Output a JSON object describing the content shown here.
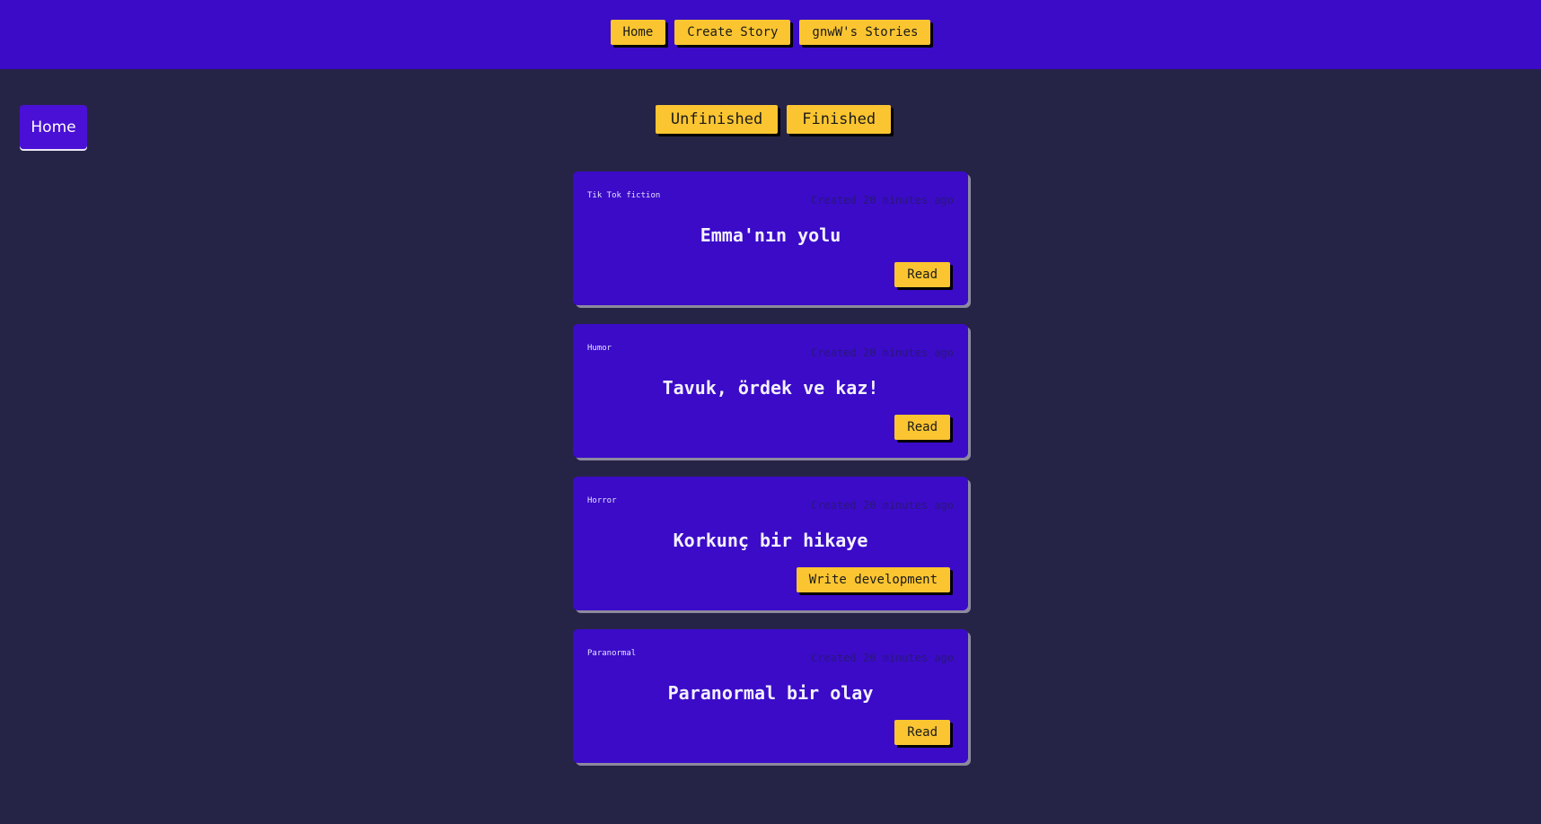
{
  "nav": {
    "home_label": "Home",
    "create_label": "Create Story",
    "stories_label": "gnwW's Stories"
  },
  "sidebar": {
    "home_label": "Home"
  },
  "filters": {
    "unfinished_label": "Unfinished",
    "finished_label": "Finished"
  },
  "stories": [
    {
      "genre": "Tik Tok fiction",
      "created": "Created 20 minutes ago",
      "title": "Emma'nın yolu",
      "action": "Read"
    },
    {
      "genre": "Humor",
      "created": "Created 20 minutes ago",
      "title": "Tavuk, ördek ve kaz!",
      "action": "Read"
    },
    {
      "genre": "Horror",
      "created": "Created 20 minutes ago",
      "title": "Korkunç bir hikaye",
      "action": "Write development"
    },
    {
      "genre": "Paranormal",
      "created": "Created 20 minutes ago",
      "title": "Paranormal bir olay",
      "action": "Read"
    }
  ],
  "colors": {
    "background": "#262446",
    "primary": "#3b0bc8",
    "accent": "#fbc531"
  }
}
